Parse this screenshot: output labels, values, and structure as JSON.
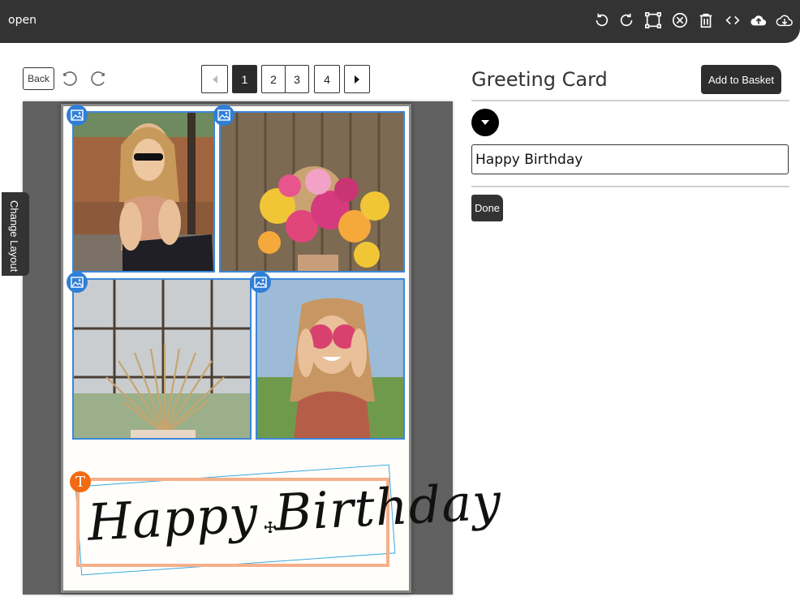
{
  "window": {
    "title": "open"
  },
  "toolbar": {
    "back_label": "Back",
    "pages": [
      "1",
      "2",
      "3",
      "4"
    ],
    "active_page": "1"
  },
  "sidebar": {
    "change_layout_label": "Change Layout"
  },
  "card_text": {
    "content": "Happy Birthday"
  },
  "panel": {
    "title": "Greeting Card",
    "add_to_basket_label": "Add to Basket",
    "text_value": "Happy Birthday",
    "done_label": "Done"
  },
  "icons": {
    "top": [
      "rotate-left-icon",
      "rotate-right-icon",
      "crop-icon",
      "delete-circle-icon",
      "trash-icon",
      "code-icon",
      "upload-cloud-icon",
      "download-cloud-icon"
    ],
    "photo_badge": "image-icon",
    "text_badge": "text-icon"
  },
  "colors": {
    "topbar": "#333333",
    "selection_blue": "#3b87d9",
    "text_frame": "#f5b08a",
    "text_badge": "#f26a12"
  }
}
